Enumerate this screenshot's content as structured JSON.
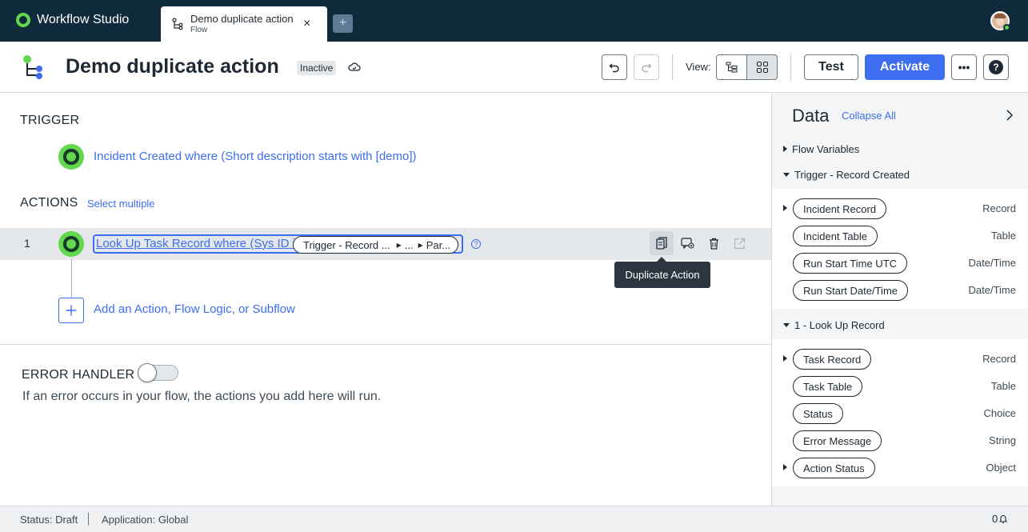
{
  "app": {
    "brand": "Workflow Studio"
  },
  "tab": {
    "title": "Demo duplicate action",
    "subtitle": "Flow",
    "close": "×",
    "new": "+"
  },
  "header": {
    "title": "Demo duplicate action",
    "status_badge": "Inactive",
    "view_label": "View:",
    "test_label": "Test",
    "activate_label": "Activate",
    "more_label": "•••",
    "help_label": "?"
  },
  "trigger": {
    "heading": "TRIGGER",
    "label": "Incident Created where (Short description starts with [demo])"
  },
  "actions": {
    "heading": "ACTIONS",
    "select_multiple": "Select multiple",
    "items": [
      {
        "number": "1",
        "label": "Look Up Task Record where (Sys ID is",
        "pill_parts": [
          "Trigger - Record ...",
          "...",
          "Par..."
        ]
      }
    ],
    "tooltip": "Duplicate Action",
    "add_label": "Add an Action, Flow Logic, or Subflow"
  },
  "error_handler": {
    "heading": "ERROR HANDLER",
    "enabled": false,
    "description": "If an error occurs in your flow, the actions you add here will run."
  },
  "data_panel": {
    "title": "Data",
    "collapse_all": "Collapse All",
    "groups": [
      {
        "label": "Flow Variables",
        "expanded": false,
        "items": []
      },
      {
        "label": "Trigger - Record Created",
        "expanded": true,
        "items": [
          {
            "name": "Incident Record",
            "type": "Record",
            "expandable": true
          },
          {
            "name": "Incident Table",
            "type": "Table",
            "expandable": false
          },
          {
            "name": "Run Start Time UTC",
            "type": "Date/Time",
            "expandable": false
          },
          {
            "name": "Run Start Date/Time",
            "type": "Date/Time",
            "expandable": false
          }
        ]
      },
      {
        "label": "1 - Look Up Record",
        "expanded": true,
        "items": [
          {
            "name": "Task Record",
            "type": "Record",
            "expandable": true
          },
          {
            "name": "Task Table",
            "type": "Table",
            "expandable": false
          },
          {
            "name": "Status",
            "type": "Choice",
            "expandable": false
          },
          {
            "name": "Error Message",
            "type": "String",
            "expandable": false
          },
          {
            "name": "Action Status",
            "type": "Object",
            "expandable": true
          }
        ]
      }
    ]
  },
  "statusbar": {
    "status": "Status: Draft",
    "application": "Application: Global",
    "notifications": "0"
  },
  "colors": {
    "brand_green": "#62d84e",
    "accent_blue": "#3d6ef0",
    "appbar": "#0f2a3a"
  }
}
